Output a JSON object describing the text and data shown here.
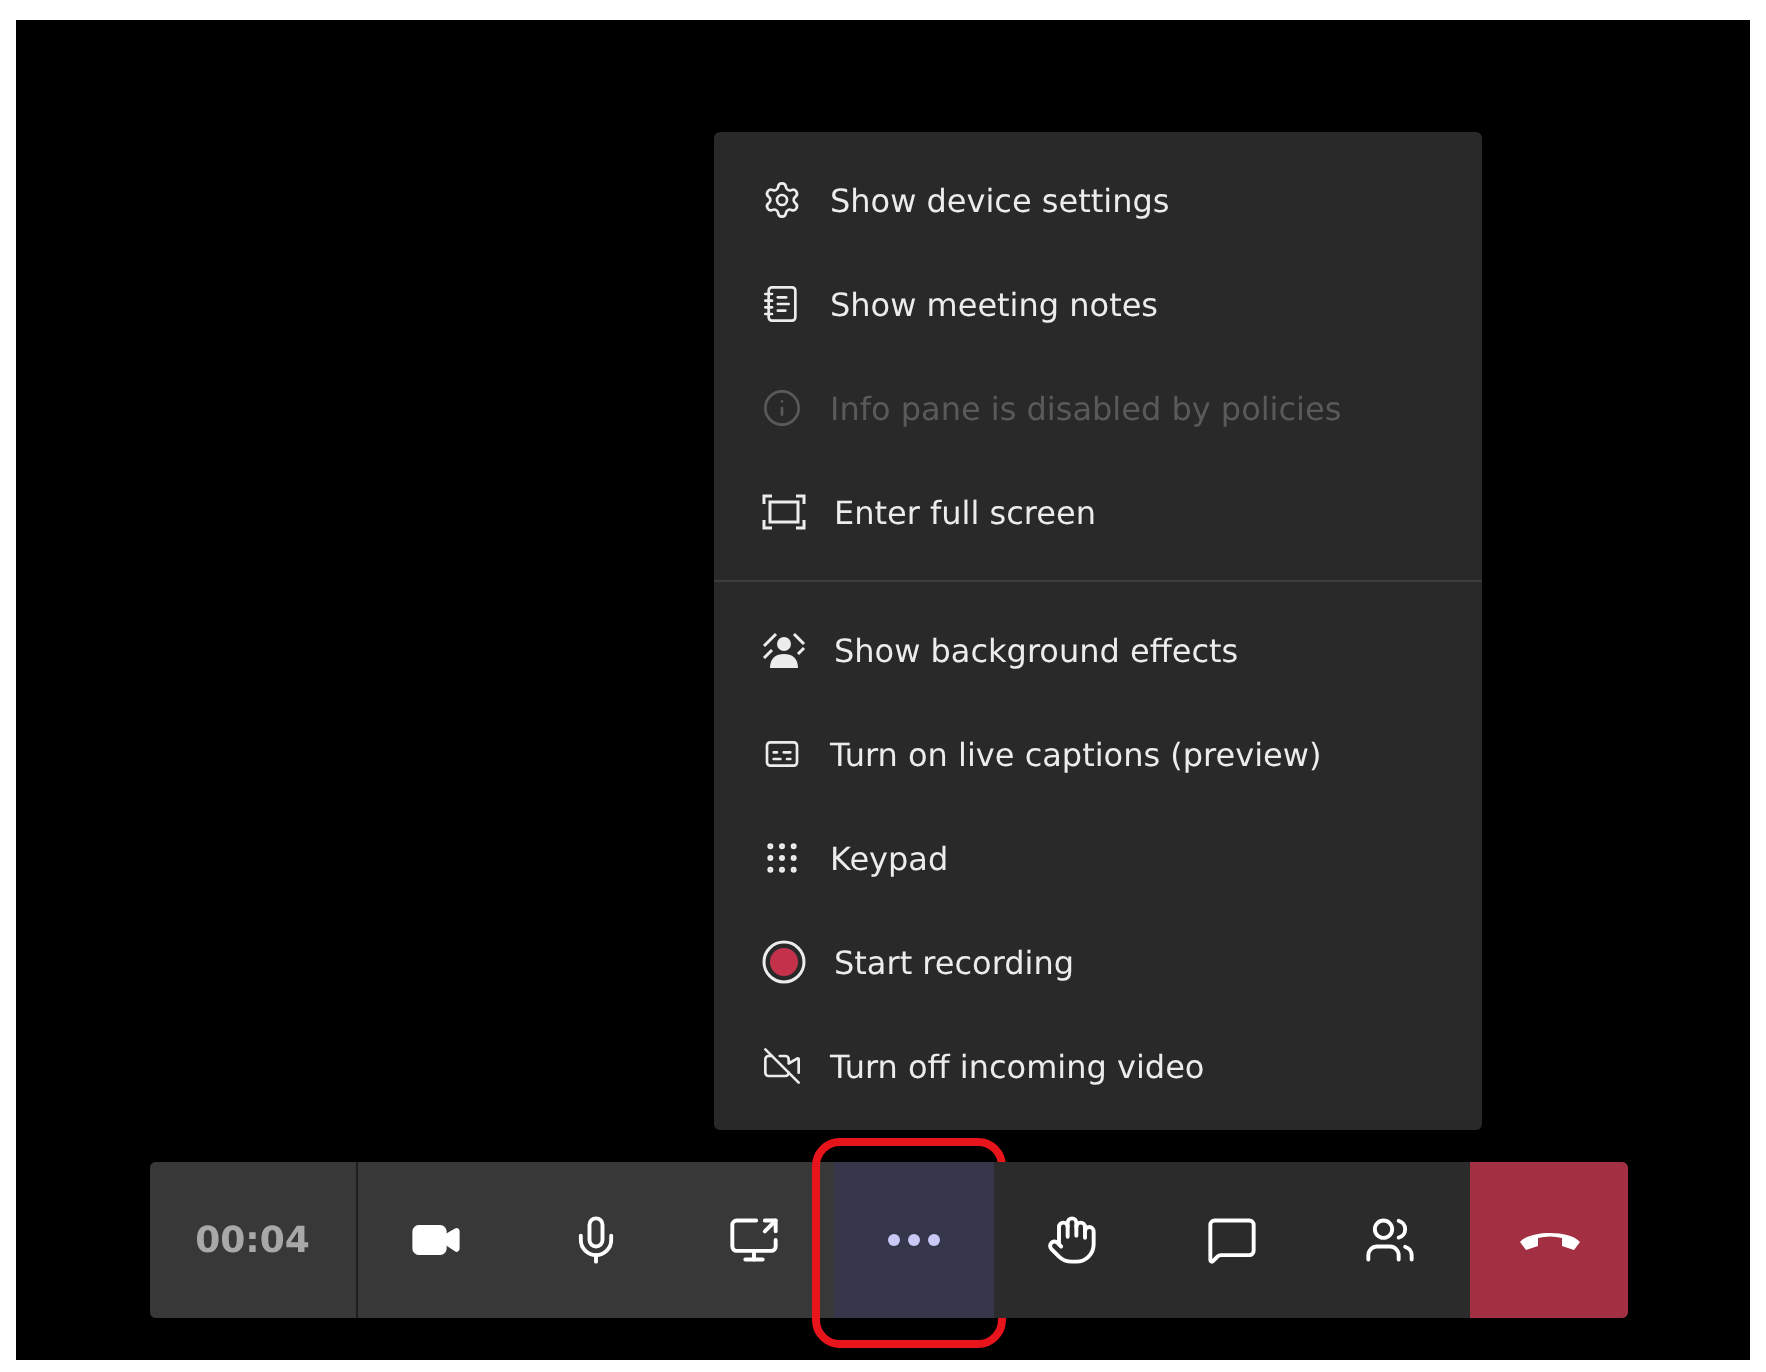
{
  "menu": {
    "groups": [
      {
        "items": [
          {
            "kind": "settings",
            "label": "Show device settings",
            "disabled": false
          },
          {
            "kind": "notes",
            "label": "Show meeting notes",
            "disabled": false
          },
          {
            "kind": "info",
            "label": "Info pane is disabled by policies",
            "disabled": true
          },
          {
            "kind": "fullscreen",
            "label": "Enter full screen",
            "disabled": false
          }
        ]
      },
      {
        "items": [
          {
            "kind": "background",
            "label": "Show background effects",
            "disabled": false
          },
          {
            "kind": "captions",
            "label": "Turn on live captions (preview)",
            "disabled": false
          },
          {
            "kind": "keypad",
            "label": "Keypad",
            "disabled": false
          },
          {
            "kind": "record",
            "label": "Start recording",
            "disabled": false
          },
          {
            "kind": "video-off",
            "label": "Turn off incoming video",
            "disabled": false
          }
        ]
      }
    ]
  },
  "toolbar": {
    "timer": "00:04",
    "buttons": [
      {
        "kind": "camera",
        "selected": false
      },
      {
        "kind": "mic",
        "selected": false
      },
      {
        "kind": "share",
        "selected": false
      },
      {
        "kind": "more",
        "selected": true
      },
      {
        "kind": "hand",
        "selected": false
      },
      {
        "kind": "chat",
        "selected": false
      },
      {
        "kind": "people",
        "selected": false
      },
      {
        "kind": "hangup",
        "selected": false
      }
    ]
  }
}
